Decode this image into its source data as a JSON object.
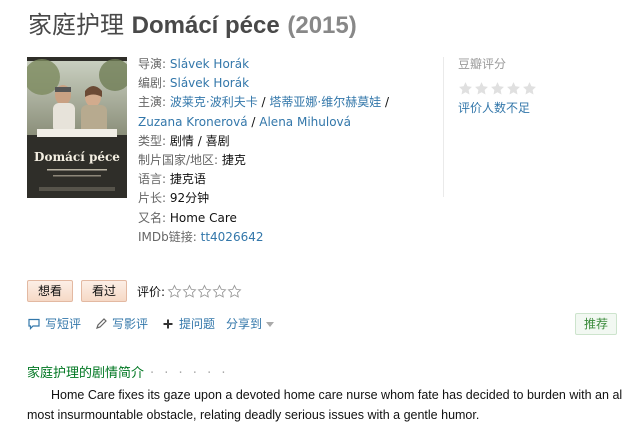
{
  "header": {
    "title_zh": "家庭护理",
    "title_original": "Domácí péce",
    "year": "(2015)"
  },
  "info": {
    "director": {
      "label": "导演:",
      "value": "Slávek Horák"
    },
    "writer": {
      "label": "编剧:",
      "value": "Slávek Horák"
    },
    "cast": {
      "label": "主演:",
      "names": [
        "波莱克·波利夫卡",
        "塔蒂亚娜·维尔赫莫娃",
        "Zuzana Kronerová",
        "Alena Mihulová"
      ],
      "separator": " / "
    },
    "genre": {
      "label": "类型:",
      "values": [
        "剧情",
        "喜剧"
      ],
      "separator": " / "
    },
    "country": {
      "label": "制片国家/地区:",
      "value": "捷克"
    },
    "language": {
      "label": "语言:",
      "value": "捷克语"
    },
    "runtime": {
      "label": "片长:",
      "value": "92分钟"
    },
    "aka": {
      "label": "又名:",
      "value": "Home Care"
    },
    "imdb": {
      "label": "IMDb链接:",
      "value": "tt4026642"
    }
  },
  "rating": {
    "label": "豆瓣评分",
    "no_rating": "评价人数不足",
    "stars": 0
  },
  "actions": {
    "want": "想看",
    "seen": "看过",
    "rate_label": "评价:",
    "rate_stars": 0
  },
  "tools": {
    "short_review": "写短评",
    "review": "写影评",
    "ask": "提问题",
    "share": "分享到",
    "recommend": "推荐"
  },
  "summary": {
    "title": "家庭护理的剧情简介",
    "dots": "· · · · · ·",
    "line1": "Home Care fixes its gaze upon a devoted home care nurse whom fate has decided to burden with an al",
    "line2": "most insurmountable obstacle, relating deadly serious issues with a gentle humor."
  },
  "poster": {
    "title_text": "Domácí péce"
  },
  "colors": {
    "link": "#3377aa",
    "section_green": "#007722",
    "button_bg": "#f6d9c6",
    "recommend_green": "#3a8a3a"
  },
  "icons": {
    "short_review": "speech-bubble-icon",
    "review": "pencil-icon",
    "ask": "plus-icon",
    "share_arrow": "caret-down-icon",
    "rating_star": "star-icon"
  }
}
